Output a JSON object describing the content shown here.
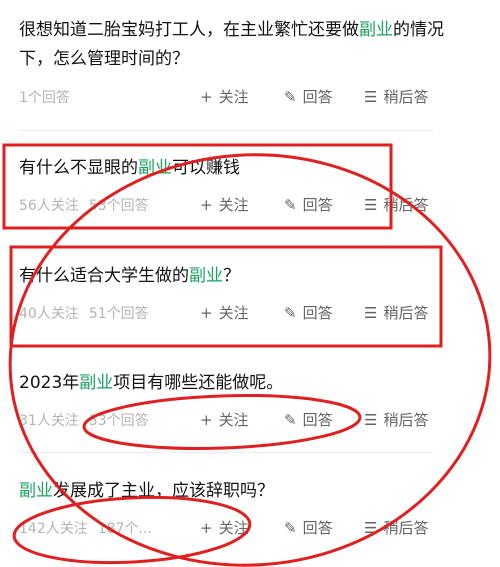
{
  "questions": [
    {
      "title_parts": [
        "很想知道二胎宝妈打工人，在主业繁忙还要做",
        "副业",
        "的情况下，怎么管理时间的？"
      ],
      "meta": [
        "1个回答"
      ]
    },
    {
      "title_parts": [
        "有什么不显眼的",
        "副业",
        "可以赚钱"
      ],
      "meta": [
        "56人关注",
        "53个回答"
      ]
    },
    {
      "title_parts": [
        "有什么适合大学生做的",
        "副业",
        "？"
      ],
      "meta": [
        "40人关注",
        "51个回答"
      ]
    },
    {
      "title_parts": [
        "2023年",
        "副业",
        "项目有哪些还能做呢。"
      ],
      "meta": [
        "31人关注",
        "53个回答"
      ]
    },
    {
      "title_parts": [
        "",
        "副业",
        "发展成了主业，应该辞职吗？"
      ],
      "meta": [
        "142人关注",
        "187个..."
      ]
    }
  ],
  "actions": {
    "follow": "关注",
    "answer": "回答",
    "later": "稍后答"
  },
  "icons": {
    "follow": "plus-icon",
    "answer": "edit-icon",
    "later": "list-icon"
  },
  "colors": {
    "highlight": "#1aa260",
    "annotation": "#e02020"
  }
}
